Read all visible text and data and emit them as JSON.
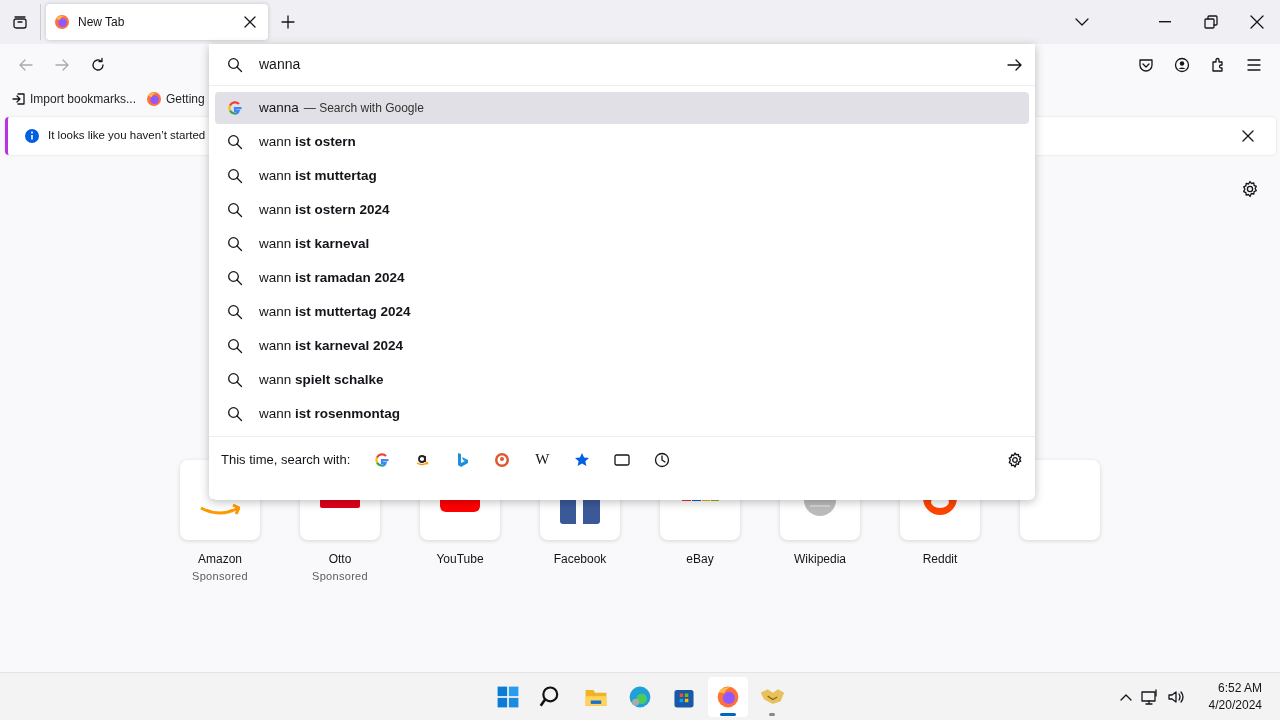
{
  "tabs": [
    {
      "title": "New Tab",
      "selected": true
    }
  ],
  "address_bar": {
    "value": "wanna"
  },
  "bookmarks": [
    {
      "kind": "import",
      "label": "Import bookmarks..."
    },
    {
      "kind": "firefox",
      "label": "Getting"
    }
  ],
  "notification": {
    "text": "It looks like you haven’t started"
  },
  "suggestions": [
    {
      "kind": "engine",
      "text": "wanna",
      "action": "— Search with Google",
      "selected": true
    },
    {
      "kind": "search",
      "text": "wann **ist ostern**",
      "selected": false
    },
    {
      "kind": "search",
      "text": "wann **ist muttertag**",
      "selected": false
    },
    {
      "kind": "search",
      "text": "wann **ist ostern 2024**",
      "selected": false
    },
    {
      "kind": "search",
      "text": "wann **ist karneval**",
      "selected": false
    },
    {
      "kind": "search",
      "text": "wann **ist ramadan 2024**",
      "selected": false
    },
    {
      "kind": "search",
      "text": "wann **ist muttertag 2024**",
      "selected": false
    },
    {
      "kind": "search",
      "text": "wann **ist karneval 2024**",
      "selected": false
    },
    {
      "kind": "search",
      "text": "wann **spielt schalke**",
      "selected": false
    },
    {
      "kind": "search",
      "text": "wann **ist rosenmontag**",
      "selected": false
    }
  ],
  "search_with": {
    "label": "This time, search with:",
    "engines": [
      {
        "kind": "google"
      },
      {
        "kind": "amazon"
      },
      {
        "kind": "bing"
      },
      {
        "kind": "duckduckgo"
      },
      {
        "kind": "wikipedia",
        "glyph": "W"
      },
      {
        "kind": "bookmarks"
      },
      {
        "kind": "tabs"
      },
      {
        "kind": "history"
      }
    ]
  },
  "top_sites": [
    {
      "kind": "amazon",
      "title": "Amazon",
      "note": "Sponsored"
    },
    {
      "kind": "otto",
      "title": "Otto",
      "note": "Sponsored"
    },
    {
      "kind": "youtube",
      "title": "YouTube"
    },
    {
      "kind": "facebook",
      "title": "Facebook"
    },
    {
      "kind": "ebay",
      "title": "eBay"
    },
    {
      "kind": "wikipedia",
      "title": "Wikipedia"
    },
    {
      "kind": "reddit",
      "title": "Reddit"
    },
    {
      "kind": "empty"
    }
  ],
  "taskbar": {
    "apps": [
      {
        "kind": "start",
        "selected": false,
        "running": false
      },
      {
        "kind": "search",
        "selected": false,
        "running": false
      },
      {
        "kind": "files",
        "selected": false,
        "running": false
      },
      {
        "kind": "edge",
        "selected": false,
        "running": false
      },
      {
        "kind": "store",
        "selected": false,
        "running": false
      },
      {
        "kind": "firefox",
        "selected": true,
        "running": true
      },
      {
        "kind": "handshake",
        "selected": false,
        "running": true
      }
    ],
    "time": "6:52 AM",
    "date": "4/20/2024"
  }
}
